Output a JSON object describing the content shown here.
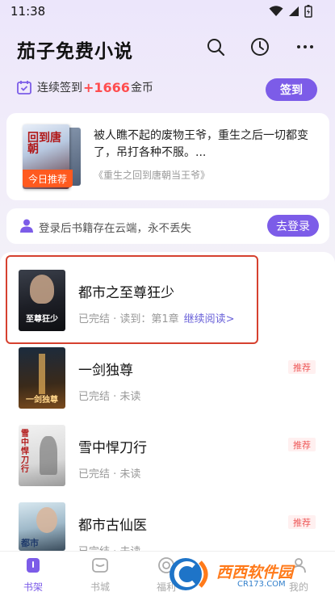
{
  "status_bar": {
    "time": "11:38"
  },
  "header": {
    "title": "茄子免费小说",
    "icons": [
      "search-icon",
      "history-icon",
      "more-icon"
    ]
  },
  "checkin": {
    "prefix": "连续签到",
    "amount": "+1666",
    "suffix": "金币",
    "button": "签到"
  },
  "daily_rec": {
    "badge": "今日推荐",
    "cover_text": "回到唐朝",
    "description": "被人瞧不起的废物王爷，重生之后一切都变了，吊打各种不服。...",
    "source": "《重生之回到唐朝当王爷》"
  },
  "login": {
    "text": "登录后书籍存在云端，永不丢失",
    "button": "去登录"
  },
  "books": [
    {
      "title": "都市之至尊狂少",
      "meta": "已完结 · 读到：第1章",
      "continue": "继续阅读>",
      "tag": "",
      "cover_text": "至尊狂少"
    },
    {
      "title": "一剑独尊",
      "meta": "已完结 · 未读",
      "continue": "",
      "tag": "推荐",
      "cover_text": "一剑独尊"
    },
    {
      "title": "雪中悍刀行",
      "meta": "已完结 · 未读",
      "continue": "",
      "tag": "推荐",
      "cover_text": "雪中悍刀行"
    },
    {
      "title": "都市古仙医",
      "meta": "已完结 · 未读",
      "continue": "",
      "tag": "推荐",
      "cover_text": "都市"
    }
  ],
  "nav": [
    {
      "label": "书架",
      "icon": "bookshelf-icon",
      "active": true
    },
    {
      "label": "书城",
      "icon": "bookstore-icon",
      "active": false
    },
    {
      "label": "福利",
      "icon": "welfare-icon",
      "active": false
    },
    {
      "label": "我的",
      "icon": "profile-icon",
      "active": false
    }
  ],
  "watermark": {
    "text": "西西软件园",
    "sub": "CR173.COM"
  },
  "colors": {
    "accent": "#7c5ce8",
    "highlight_red": "#ff4d4f",
    "badge_orange": "#ff5a1f",
    "tag_red": "#ee5a5a"
  }
}
